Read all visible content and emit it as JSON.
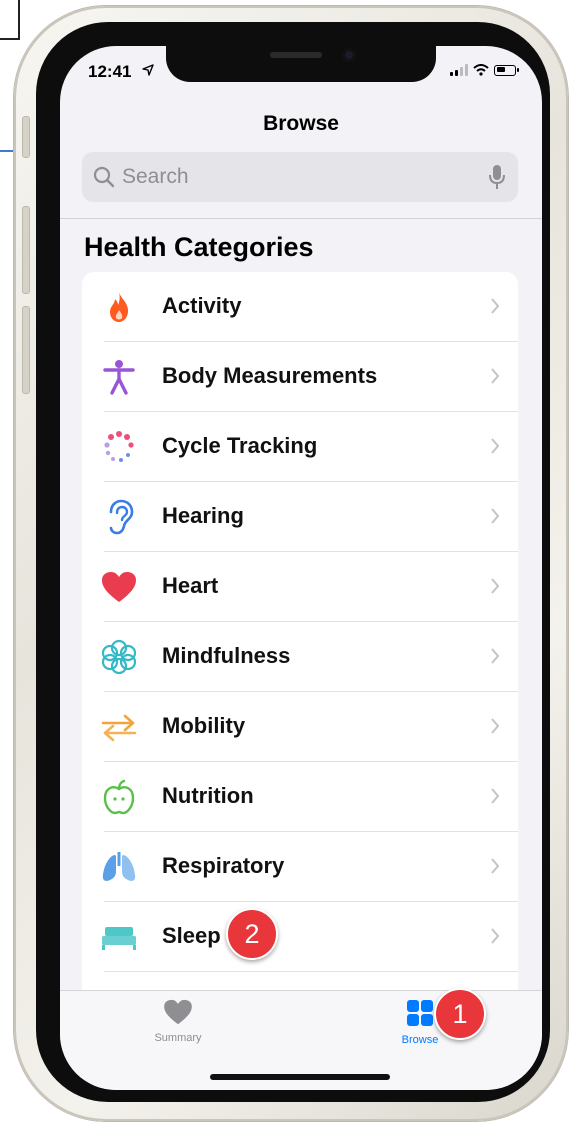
{
  "status_bar": {
    "time": "12:41"
  },
  "nav": {
    "title": "Browse"
  },
  "search": {
    "placeholder": "Search"
  },
  "section": {
    "title": "Health Categories"
  },
  "categories": [
    {
      "label": "Activity",
      "icon": "flame-icon",
      "color": "#ff5a1f"
    },
    {
      "label": "Body Measurements",
      "icon": "figure-icon",
      "color": "#9a55d6"
    },
    {
      "label": "Cycle Tracking",
      "icon": "cycle-dots-icon",
      "color": "#ee4f7a"
    },
    {
      "label": "Hearing",
      "icon": "ear-icon",
      "color": "#3a7be6"
    },
    {
      "label": "Heart",
      "icon": "heart-icon",
      "color": "#ea3c4f"
    },
    {
      "label": "Mindfulness",
      "icon": "mindfulness-flower-icon",
      "color": "#34b9c7"
    },
    {
      "label": "Mobility",
      "icon": "mobility-arrows-icon",
      "color": "#f2a33a"
    },
    {
      "label": "Nutrition",
      "icon": "apple-icon",
      "color": "#5bbf4a"
    },
    {
      "label": "Respiratory",
      "icon": "lungs-icon",
      "color": "#5b9fe6"
    },
    {
      "label": "Sleep",
      "icon": "bed-icon",
      "color": "#4fc7c9"
    }
  ],
  "tabs": [
    {
      "label": "Summary",
      "icon": "heart-icon",
      "active": false
    },
    {
      "label": "Browse",
      "icon": "grid-icon",
      "active": true
    }
  ],
  "callouts": [
    {
      "number": "1",
      "target": "Browse"
    },
    {
      "number": "2",
      "target": "Sleep"
    }
  ],
  "colors": {
    "accent": "#007aff",
    "badge": "#e8363b"
  }
}
